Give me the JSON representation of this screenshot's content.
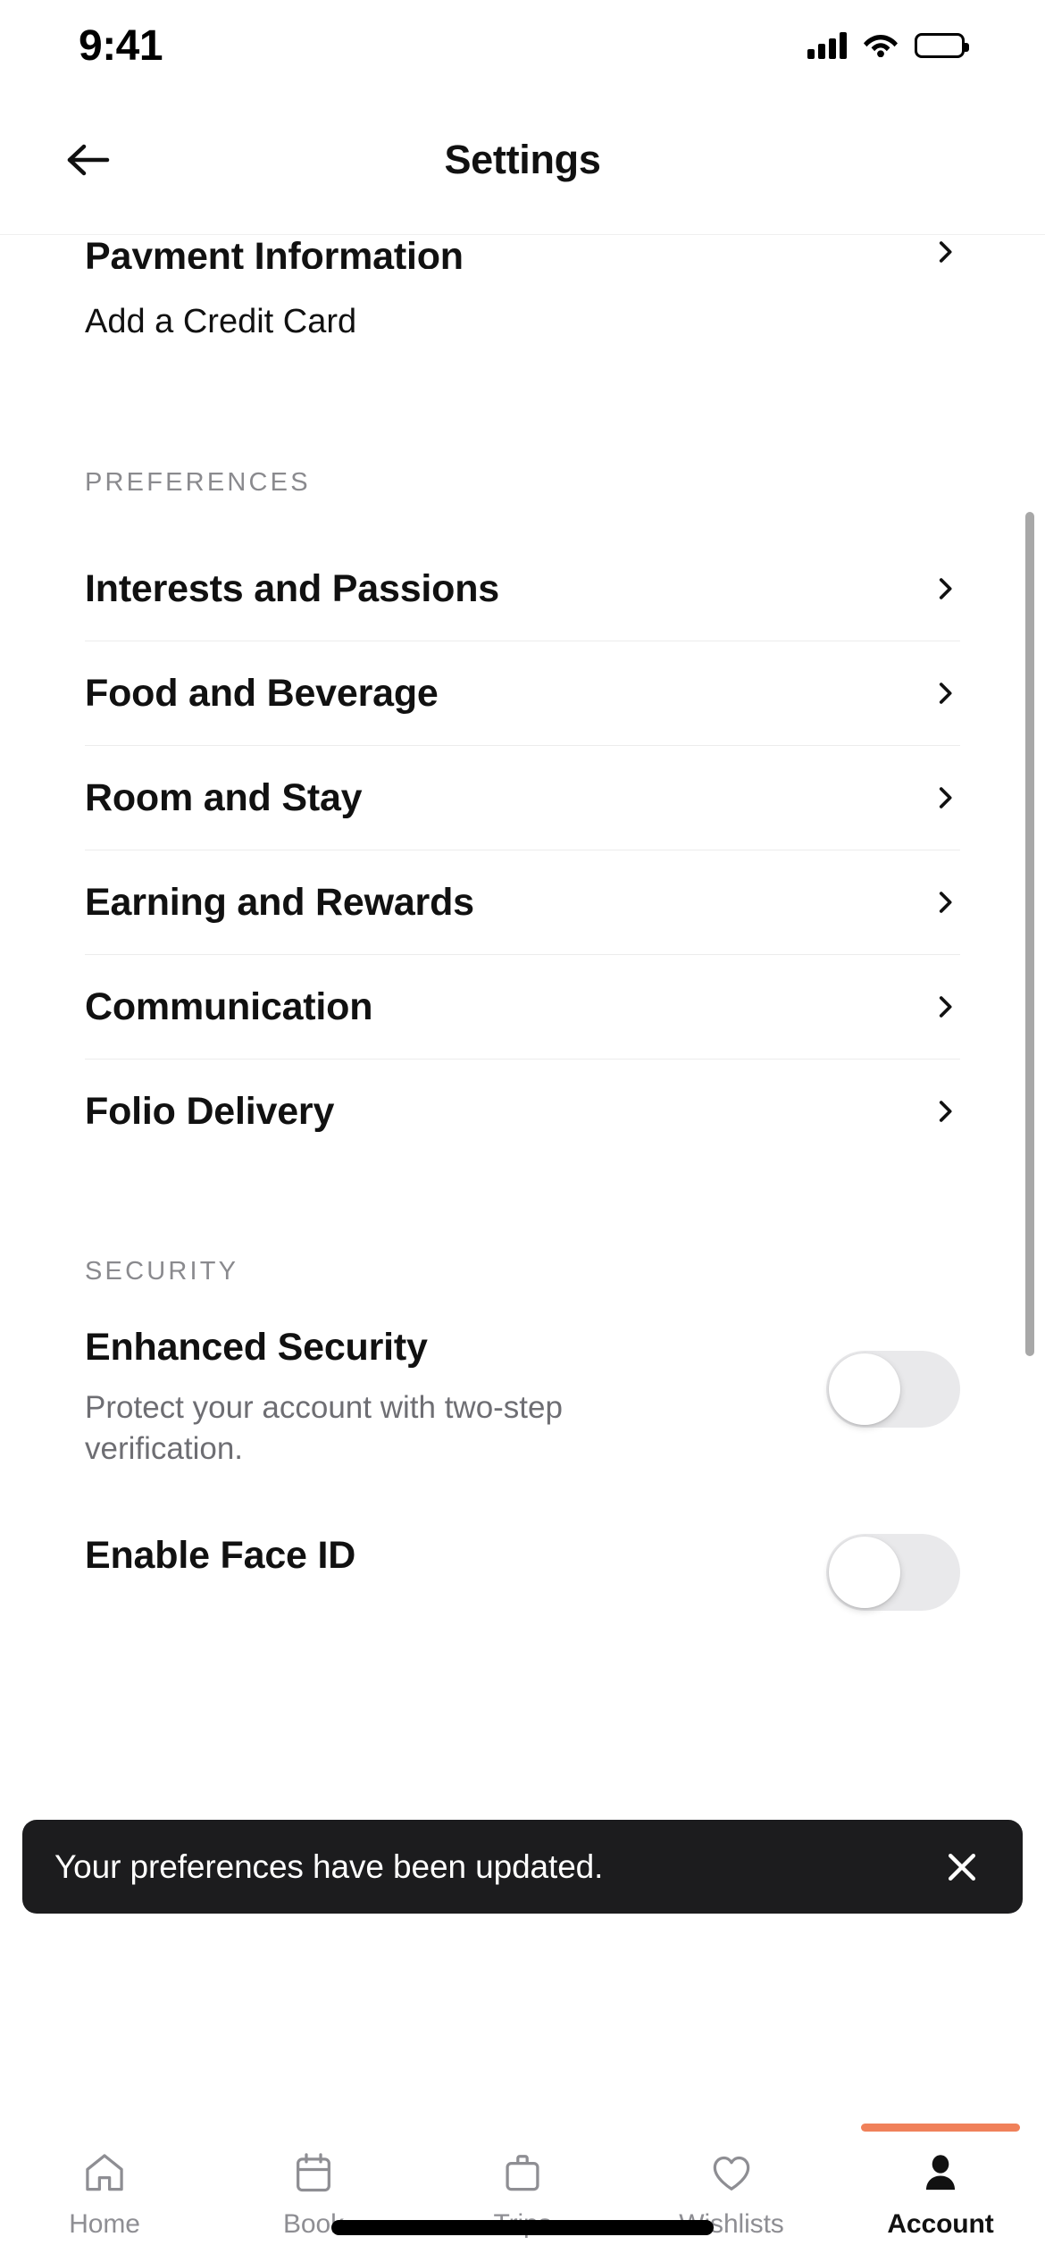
{
  "status_bar": {
    "time": "9:41",
    "cellular_icon": "signal-bars-icon",
    "wifi_icon": "wifi-icon",
    "battery_icon": "battery-full-icon"
  },
  "header": {
    "back_icon": "arrow-left-icon",
    "title": "Settings"
  },
  "account_section": {
    "payment_row": {
      "label": "Payment Information",
      "chevron_icon": "chevron-right-icon"
    },
    "add_card_row": {
      "label": "Add a Credit Card"
    }
  },
  "preferences": {
    "section_title": "PREFERENCES",
    "items": [
      {
        "label": "Interests and Passions",
        "chevron_icon": "chevron-right-icon"
      },
      {
        "label": "Food and Beverage",
        "chevron_icon": "chevron-right-icon"
      },
      {
        "label": "Room and Stay",
        "chevron_icon": "chevron-right-icon"
      },
      {
        "label": "Earning and Rewards",
        "chevron_icon": "chevron-right-icon"
      },
      {
        "label": "Communication",
        "chevron_icon": "chevron-right-icon"
      },
      {
        "label": "Folio Delivery",
        "chevron_icon": "chevron-right-icon"
      }
    ]
  },
  "security": {
    "section_title": "SECURITY",
    "items": [
      {
        "title": "Enhanced Security",
        "description": "Protect your account with two-step verification.",
        "toggle_state": "off"
      },
      {
        "title": "Enable Face ID",
        "description": "",
        "toggle_state": "off"
      }
    ]
  },
  "toast": {
    "message": "Your preferences have been updated.",
    "close_icon": "close-x-icon",
    "background_color": "#1c1c1e"
  },
  "tab_bar": {
    "active_accent_color": "#f0815a",
    "tabs": [
      {
        "label": "Home",
        "icon": "home-icon",
        "active": false
      },
      {
        "label": "Book",
        "icon": "calendar-icon",
        "active": false
      },
      {
        "label": "Trips",
        "icon": "suitcase-icon",
        "active": false
      },
      {
        "label": "Wishlists",
        "icon": "heart-icon",
        "active": false
      },
      {
        "label": "Account",
        "icon": "person-icon",
        "active": true
      }
    ]
  }
}
